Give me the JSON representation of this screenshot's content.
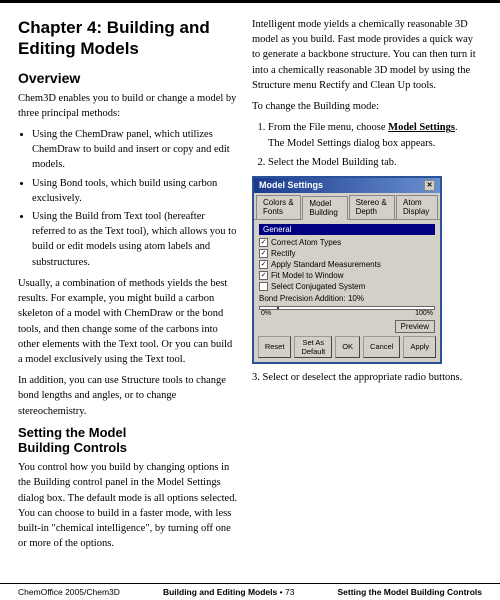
{
  "page": {
    "top_border": true,
    "chapter_title": "Chapter 4: Building and Editing Models",
    "overview_heading": "Overview",
    "overview_intro": "Chem3D enables you to build or change a model by three principal methods:",
    "bullet_points": [
      "Using the ChemDraw panel, which utilizes ChemDraw to build and insert or copy and edit models.",
      "Using Bond tools, which build using carbon exclusively.",
      "Using the Build from Text tool (hereafter referred to as the Text tool), which allows you to build or edit models using atom labels and substructures."
    ],
    "overview_para2": "Usually, a combination of methods yields the best results. For example, you might build a carbon skeleton of a model with ChemDraw or the bond tools, and then change some of the carbons into other elements with the Text tool. Or you can build a model exclusively using the Text tool.",
    "overview_para3": "In addition, you can use Structure tools to change bond lengths and angles, or to change stereochemistry.",
    "setting_heading": "Setting the Model Building Controls",
    "setting_para1": "You control how you build by changing options in the Building control panel in the Model Settings dialog box. The default mode is all options selected. You can choose to build in a faster mode, with less built-in \"chemical intelligence\", by turning off one or more of the options.",
    "right_col_para1": "Intelligent mode yields a chemically reasonable 3D model as you build. Fast mode provides a quick way to generate a backbone structure. You can then turn it into a chemically reasonable 3D model by using the Structure menu Rectify and Clean Up tools.",
    "right_col_to_change": "To change the Building mode:",
    "steps": [
      {
        "num": 1,
        "text": "From the File menu, choose Model Settings.",
        "sub": "The Model Settings dialog box appears."
      },
      {
        "num": 2,
        "text": "Select the Model Building tab."
      }
    ],
    "step3": "3.  Select or deselect the appropriate radio buttons.",
    "dialog": {
      "title": "Model Settings",
      "tabs": [
        "Colors & Fonts",
        "Model Building",
        "Stereo & Depth",
        "Atom Display"
      ],
      "active_tab": "Model Building",
      "general_label": "General",
      "checkboxes": [
        {
          "label": "Correct Atom Types",
          "checked": true
        },
        {
          "label": "Rectify",
          "checked": true
        },
        {
          "label": "Apply Standard Measurements",
          "checked": true
        },
        {
          "label": "Fit Model to Window",
          "checked": true
        },
        {
          "label": "Select Conjugated System",
          "checked": false
        }
      ],
      "slider_label": "Bond Precision Addition: 10%",
      "slider_min": "0%",
      "slider_max": "100%",
      "buttons": [
        "Reset",
        "Set As Default",
        "OK",
        "Cancel",
        "Apply"
      ],
      "preview_label": "Preview"
    },
    "footer": {
      "left": "ChemOffice 2005/Chem3D",
      "center_line1": "Building and Editing Models",
      "center_bullet": "•",
      "center_page": "73",
      "right_line1": "Setting the Model Building Controls"
    }
  }
}
